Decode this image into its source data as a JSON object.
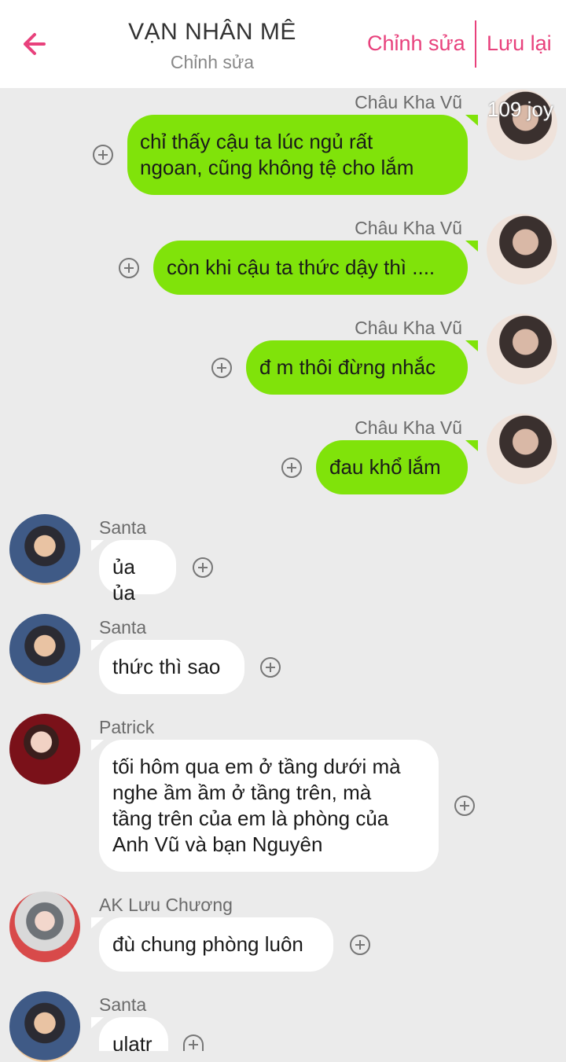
{
  "header": {
    "title": "VẠN NHÂN MÊ",
    "subtitle": "Chỉnh sửa",
    "edit_label": "Chỉnh sửa",
    "save_label": "Lưu lại",
    "accent_color": "#e8417c"
  },
  "watermark": "109 joy",
  "messages": [
    {
      "sender": "Châu Kha Vũ",
      "side": "right",
      "text": [
        "chỉ thấy cậu ta lúc ngủ rất",
        "ngoan, cũng không tệ cho lắm"
      ]
    },
    {
      "sender": "Châu Kha Vũ",
      "side": "right",
      "text": [
        "còn khi cậu ta thức dậy thì ...."
      ]
    },
    {
      "sender": "Châu Kha Vũ",
      "side": "right",
      "text": [
        "đ m thôi đừng nhắc"
      ]
    },
    {
      "sender": "Châu Kha Vũ",
      "side": "right",
      "text": [
        "đau khổ lắm"
      ]
    },
    {
      "sender": "Santa",
      "side": "left",
      "text": [
        "ủa ủa"
      ]
    },
    {
      "sender": "Santa",
      "side": "left",
      "text": [
        "thức thì sao"
      ]
    },
    {
      "sender": "Patrick",
      "side": "left",
      "text": [
        "tối hôm qua em ở tầng dưới mà",
        "nghe ầm ầm ở tầng trên, mà",
        "tầng trên của em là phòng của",
        "Anh Vũ và bạn Nguyên"
      ]
    },
    {
      "sender": "AK Lưu Chương",
      "side": "left",
      "text": [
        "đù chung phòng luôn"
      ]
    },
    {
      "sender": "Santa",
      "side": "left",
      "text": [
        "ulatr"
      ]
    }
  ],
  "colors": {
    "outgoing_bubble": "#80e30a",
    "incoming_bubble": "#ffffff",
    "background": "#ebebeb"
  },
  "icons": {
    "back": "arrow-left-icon",
    "add": "plus-circle-icon"
  }
}
